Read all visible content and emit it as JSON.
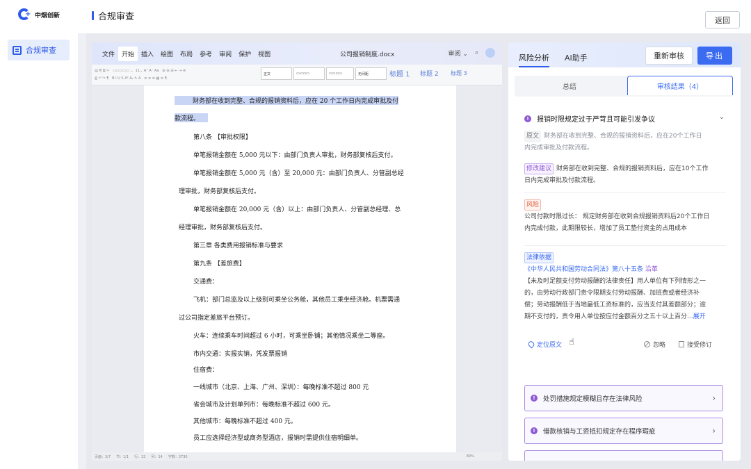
{
  "app": {
    "logo_text": "中烟创新",
    "page_title": "合规审查",
    "back_label": "返回"
  },
  "sidebar": {
    "items": [
      {
        "label": "合规审查"
      }
    ]
  },
  "editor": {
    "tabs": [
      "文件",
      "开始",
      "插入",
      "绘图",
      "布局",
      "参考",
      "审阅",
      "保护",
      "视图"
    ],
    "active_tab": "开始",
    "doc_name": "公司报销制度.docx",
    "review_label": "审阅",
    "toolbar": {
      "font_name": "正文",
      "styles": [
        "正文",
        "无间距"
      ],
      "headings": [
        "标题 1",
        "标题 2",
        "标题 3"
      ]
    },
    "lines": [
      "财务部在收到完整、合规的报销资料后，应在 20 个工作日内完成审批及付",
      "款流程。",
      "第八条 【审批权限】",
      "单笔报销金额在 5,000 元以下：由部门负责人审批，财务部复核后支付。",
      "单笔报销金额在 5,000 元（含）至 20,000 元：由部门负责人、分管副总经",
      "理审批，财务部复核后支付。",
      "单笔报销金额在 20,000 元（含）以上：由部门负责人、分管副总经理、总",
      "经理审批，财务部复核后支付。",
      "第三章 各类费用报销标准与要求",
      "第九条 【差旅费】",
      "交通费：",
      "飞机：部门总监及以上级别可乘坐公务舱，其他员工乘坐经济舱。机票需通",
      "过公司指定差旅平台预订。",
      "火车：连续乘车时间超过 6 小时，可乘坐卧铺；其他情况乘坐二等座。",
      "市内交通：实报实销，凭发票报销",
      "住宿费：",
      "一线城市（北京、上海、广州、深圳）：每晚标准不超过 800 元",
      "省会城市及计划单列市：每晚标准不超过 600 元。",
      "其他城市：每晚标准不超过 400 元。",
      "员工应选择经济型或商务型酒店，报销时需提供住宿明细单。"
    ],
    "status": {
      "page": "页面：3/7",
      "section": "节：1/1",
      "row": "行：22",
      "col": "列：14",
      "words": "字数：2730",
      "zoom": "80%"
    }
  },
  "panel": {
    "tabs": [
      "风险分析",
      "AI助手"
    ],
    "rereview_label": "重新审核",
    "export_label": "导出",
    "subtabs": [
      "总结",
      "审核结果（4）"
    ],
    "issue": {
      "title": "报销时限规定过于严苛且可能引发争议",
      "original_tag": "原文",
      "original_text_1": "财务部在收到完整、合规的报销资料后，应在20个工作日",
      "original_text_2": "内完成审批及付款流程。",
      "suggest_tag": "修改建议",
      "suggest_text_1": "财务部在收到完整、合规的报销资料后，应在10个工作",
      "suggest_text_2": "日内完成审批及付款流程。",
      "risk_tag": "风险",
      "risk_text_1": "公司付款时限过长： 规定财务部在收到合规报销资料后20个工作日",
      "risk_text_2": "内完成付款，此期限较长，增加了员工垫付资金的占用成本",
      "law_tag": "法律依据",
      "law_title": "《中华人民共和国劳动合同法》第八十五条",
      "law_link": "沿革",
      "law_text_1": "【未及时足额支付劳动报酬的法律责任】用人单位有下列情形之一",
      "law_text_2": "的，由劳动行政部门责令限期支付劳动报酬、加班费或者经济补",
      "law_text_3": "偿；劳动报酬低于当地最低工资标准的，应当支付其差额部分；逾",
      "law_text_4": "期不支付的，责令用人单位按应付金额百分之五十以上百分...",
      "expand_label": "展开",
      "locate_label": "定位原文",
      "ignore_label": "忽略",
      "accept_label": "接受修订"
    },
    "collapsed_issues": [
      "处罚措施规定模糊且存在法律风险",
      "借款核销与工资抵扣规定存在程序瑕疵"
    ]
  },
  "colors": {
    "accent": "#3b6bf0",
    "purple": "#8e5ad6",
    "risk": "#e05a3a"
  }
}
